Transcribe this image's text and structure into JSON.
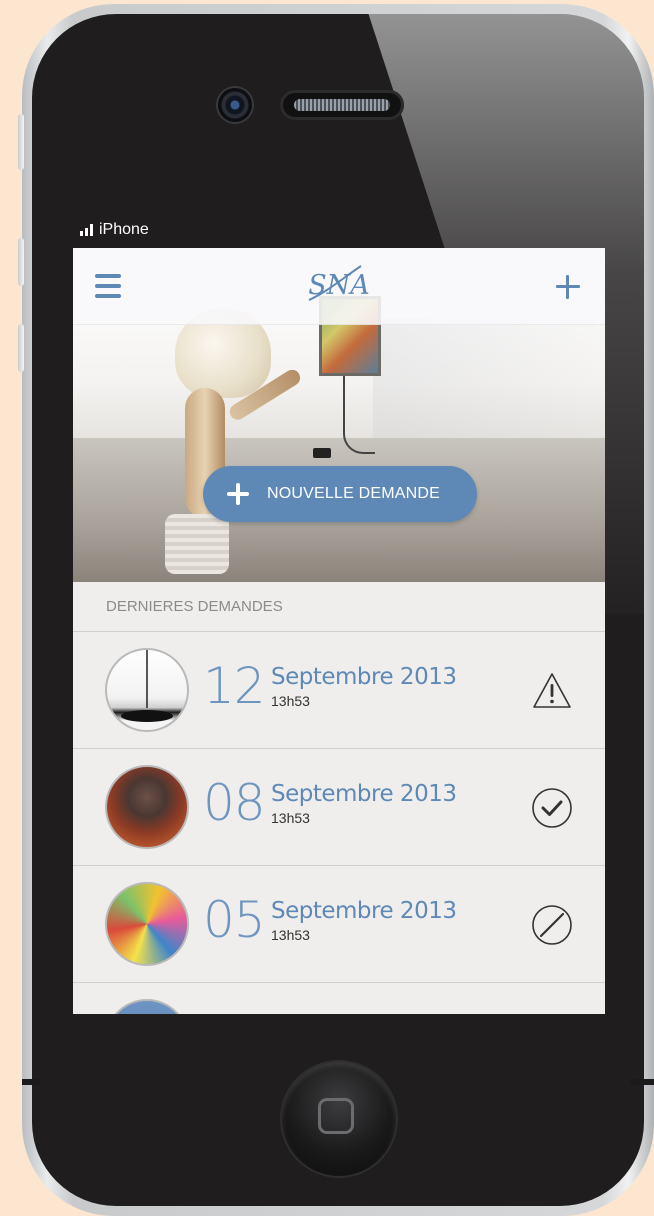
{
  "device": {
    "carrier_label": "iPhone"
  },
  "app": {
    "logo_text": "SNA",
    "cta_label": "NOUVELLE DEMANDE",
    "section_title": "DERNIERES DEMANDES"
  },
  "requests": [
    {
      "day": "12",
      "month_year": "Septembre 2013",
      "time": "13h53",
      "status_icon": "warning-icon"
    },
    {
      "day": "08",
      "month_year": "Septembre 2013",
      "time": "13h53",
      "status_icon": "check-circle-icon"
    },
    {
      "day": "05",
      "month_year": "Septembre 2013",
      "time": "13h53",
      "status_icon": "cancel-circle-icon"
    }
  ],
  "colors": {
    "accent": "#5e89b6",
    "list_background": "#efeeed",
    "divider": "#cfcfcf",
    "frame": "#1f1d1e"
  }
}
